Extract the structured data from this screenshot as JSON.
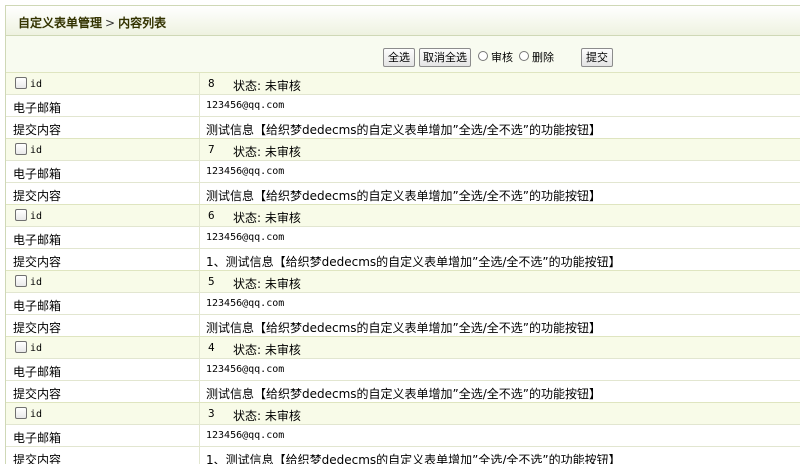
{
  "breadcrumb": {
    "parent": "自定义表单管理",
    "separator": ">",
    "current": "内容列表"
  },
  "toolbar": {
    "select_all_label": "全选",
    "deselect_all_label": "取消全选",
    "approve_label": "审核",
    "delete_label": "删除",
    "submit_label": "提交"
  },
  "labels": {
    "id": "id",
    "email": "电子邮箱",
    "content": "提交内容"
  },
  "records": [
    {
      "id": "8",
      "status": "状态: 未审核",
      "email": "123456@qq.com",
      "content": "测试信息【给织梦dedecms的自定义表单增加”全选/全不选”的功能按钮】"
    },
    {
      "id": "7",
      "status": "状态: 未审核",
      "email": "123456@qq.com",
      "content": "测试信息【给织梦dedecms的自定义表单增加”全选/全不选”的功能按钮】"
    },
    {
      "id": "6",
      "status": "状态: 未审核",
      "email": "123456@qq.com",
      "content": "1、测试信息【给织梦dedecms的自定义表单增加”全选/全不选”的功能按钮】"
    },
    {
      "id": "5",
      "status": "状态: 未审核",
      "email": "123456@qq.com",
      "content": "测试信息【给织梦dedecms的自定义表单增加”全选/全不选”的功能按钮】"
    },
    {
      "id": "4",
      "status": "状态: 未审核",
      "email": "123456@qq.com",
      "content": "测试信息【给织梦dedecms的自定义表单增加”全选/全不选”的功能按钮】"
    },
    {
      "id": "3",
      "status": "状态: 未审核",
      "email": "123456@qq.com",
      "content": "1、测试信息【给织梦dedecms的自定义表单增加”全选/全不选”的功能按钮】"
    }
  ]
}
